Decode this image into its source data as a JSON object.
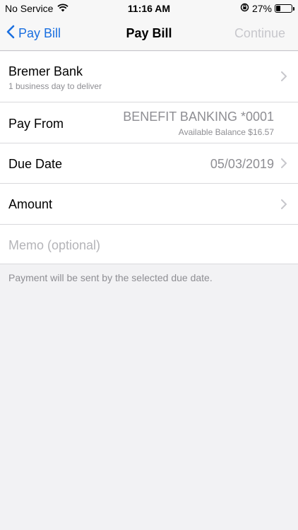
{
  "status_bar": {
    "carrier": "No Service",
    "time": "11:16 AM",
    "battery_pct": "27%",
    "battery_level": 0.27,
    "icons": [
      "wifi-icon",
      "orientation-lock-icon",
      "battery-icon"
    ]
  },
  "nav": {
    "back_label": "Pay Bill",
    "title": "Pay Bill",
    "continue_label": "Continue",
    "colors": {
      "accent": "#1a6fe0",
      "disabled": "#c7c7cc"
    }
  },
  "payee": {
    "name": "Bremer Bank",
    "delivery": "1 business day to deliver"
  },
  "pay_from": {
    "label": "Pay From",
    "account": "BENEFIT BANKING *0001",
    "balance": "Available Balance $16.57"
  },
  "due_date": {
    "label": "Due Date",
    "value": "05/03/2019"
  },
  "amount": {
    "label": "Amount"
  },
  "memo": {
    "placeholder": "Memo (optional)"
  },
  "footnote": "Payment will be sent by the selected due date."
}
